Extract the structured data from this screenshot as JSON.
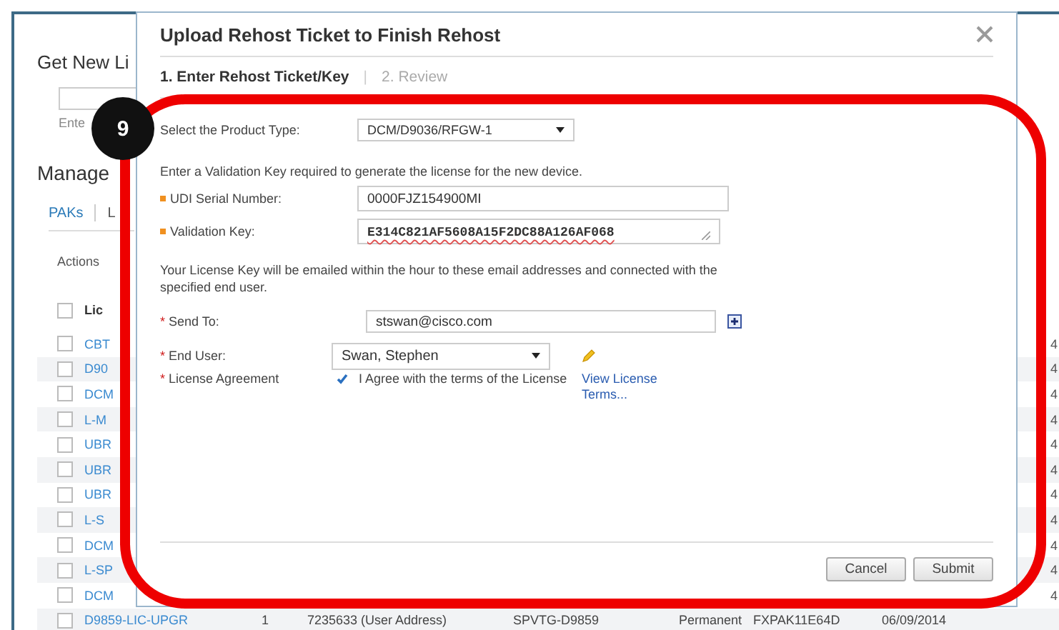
{
  "background_page": {
    "heading": "Get New Li",
    "hint": "Ente",
    "section": "Manage",
    "tabs": [
      {
        "label": "PAKs",
        "selected": true
      },
      {
        "label": "L",
        "selected": false
      }
    ],
    "actions": "Actions",
    "header_checked": false,
    "column_header": "Lic",
    "rows": [
      {
        "kind": "partial",
        "checked": false,
        "product": "CBT",
        "column_end": "4"
      },
      {
        "kind": "partial",
        "checked": false,
        "product": "D90",
        "column_end": "4"
      },
      {
        "kind": "partial",
        "checked": false,
        "product": "DCM",
        "column_end": "4"
      },
      {
        "kind": "partial",
        "checked": false,
        "product": "L-M",
        "column_end": "4"
      },
      {
        "kind": "partial",
        "checked": false,
        "product": "UBR",
        "column_end": "4"
      },
      {
        "kind": "partial",
        "checked": false,
        "product": "UBR",
        "column_end": "4"
      },
      {
        "kind": "partial",
        "checked": false,
        "product": "UBR",
        "column_end": "4"
      },
      {
        "kind": "partial",
        "checked": false,
        "product": "L-S",
        "column_end": "4"
      },
      {
        "kind": "partial",
        "checked": false,
        "product": "DCM",
        "column_end": "4"
      },
      {
        "kind": "partial",
        "checked": false,
        "product": "L-SP",
        "column_end": "4"
      },
      {
        "kind": "partial",
        "checked": false,
        "product": "DCM",
        "column_end": "4"
      },
      {
        "kind": "full",
        "checked": false,
        "product": "D9859-LIC-UPGR",
        "cells": [
          "1",
          "7235633 (User Address)",
          "SPVTG-D9859",
          "Permanent",
          "FXPAK11E64D",
          "06/09/2014"
        ]
      }
    ]
  },
  "dialog": {
    "title": "Upload Rehost Ticket to Finish Rehost",
    "steps": [
      {
        "label": "1. Enter Rehost Ticket/Key",
        "selected": true
      },
      {
        "label": "2. Review",
        "selected": false
      }
    ],
    "step_separator": "|",
    "product_type": {
      "label": "Select the Product Type:",
      "value": "DCM/D9036/RFGW-1"
    },
    "instruction": "Enter a Validation Key required to generate the license for the new device.",
    "key_fields": [
      {
        "kind": "input",
        "required": true,
        "label": "UDI Serial Number:",
        "value": "0000FJZ154900MI"
      },
      {
        "kind": "textarea",
        "required": true,
        "label": "Validation Key:",
        "value": "E314C821AF5608A15F2DC88A126AF068"
      }
    ],
    "note": "Your License Key will be emailed within the hour to these email addresses and connected with the specified end user.",
    "recipient_fields": [
      {
        "kind": "input",
        "marker": "*",
        "label": "Send To:",
        "value": "stswan@cisco.com"
      },
      {
        "kind": "select",
        "marker": "*",
        "label": "End User:",
        "value": "Swan, Stephen"
      },
      {
        "kind": "checkbox",
        "marker": "*",
        "label": "License Agreement",
        "checked": true,
        "text": "I Agree with the terms of the License",
        "link": "View License Terms..."
      }
    ],
    "buttons": [
      "Cancel",
      "Submit"
    ]
  },
  "annotation": {
    "badge": "9"
  }
}
